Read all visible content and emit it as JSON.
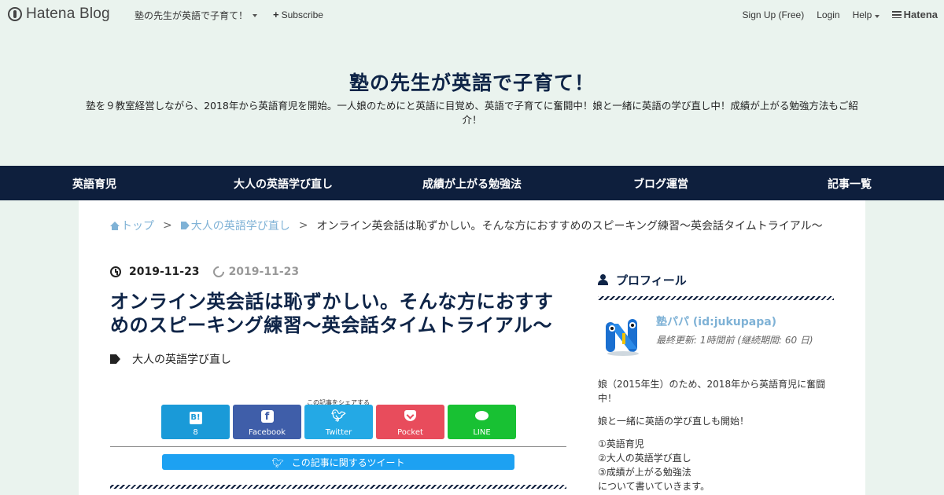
{
  "topbar": {
    "logo_text": "Hatena Blog",
    "blog_title": "塾の先生が英語で子育て！",
    "subscribe": "Subscribe",
    "signup": "Sign Up (Free)",
    "login": "Login",
    "help": "Help",
    "hatena": "Hatena"
  },
  "header": {
    "title": "塾の先生が英語で子育て！",
    "description": "塾を９教室経営しながら、2018年から英語育児を開始。一人娘のためにと英語に目覚め、英語で子育てに奮闘中！娘と一緒に英語の学び直し中！成績が上がる勉強方法もご紹介！"
  },
  "nav": {
    "items": [
      "英語育児",
      "大人の英語学び直し",
      "成績が上がる勉強法",
      "ブログ運営",
      "記事一覧"
    ]
  },
  "breadcrumb": {
    "home": "トップ",
    "category": "大人の英語学び直し",
    "current": "オンライン英会話は恥ずかしい。そんな方におすすめのスピーキング練習～英会話タイムトライアル～",
    "sep": ">"
  },
  "article": {
    "published": "2019-11-23",
    "updated": "2019-11-23",
    "title": "オンライン英会話は恥ずかしい。そんな方におすすめのスピーキング練習～英会話タイムトライアル～",
    "category": "大人の英語学び直し",
    "share_label": "この記事をシェアする",
    "share": {
      "hatena_count": "8",
      "hatena_icon": "B!",
      "facebook": "Facebook",
      "twitter": "Twitter",
      "pocket": "Pocket",
      "line": "LINE"
    },
    "tweet_bar": "この記事に関するツイート"
  },
  "sidebar": {
    "profile_heading": "プロフィール",
    "name": "塾パパ (id:jukupapa)",
    "last_update": "最終更新: 1時間前 (継続期間: 60 日)",
    "bio": [
      "娘（2015年生）のため、2018年から英語育児に奮闘中！",
      "娘と一緒に英語の学び直しも開始！"
    ],
    "list": [
      "①英語育児",
      "②大人の英語学び直し",
      "③成績が上がる勉強法",
      "について書いていきます。"
    ]
  },
  "colors": {
    "navy": "#0e1f3d",
    "link": "#7fb2d6",
    "background": "#eaf3ee"
  }
}
